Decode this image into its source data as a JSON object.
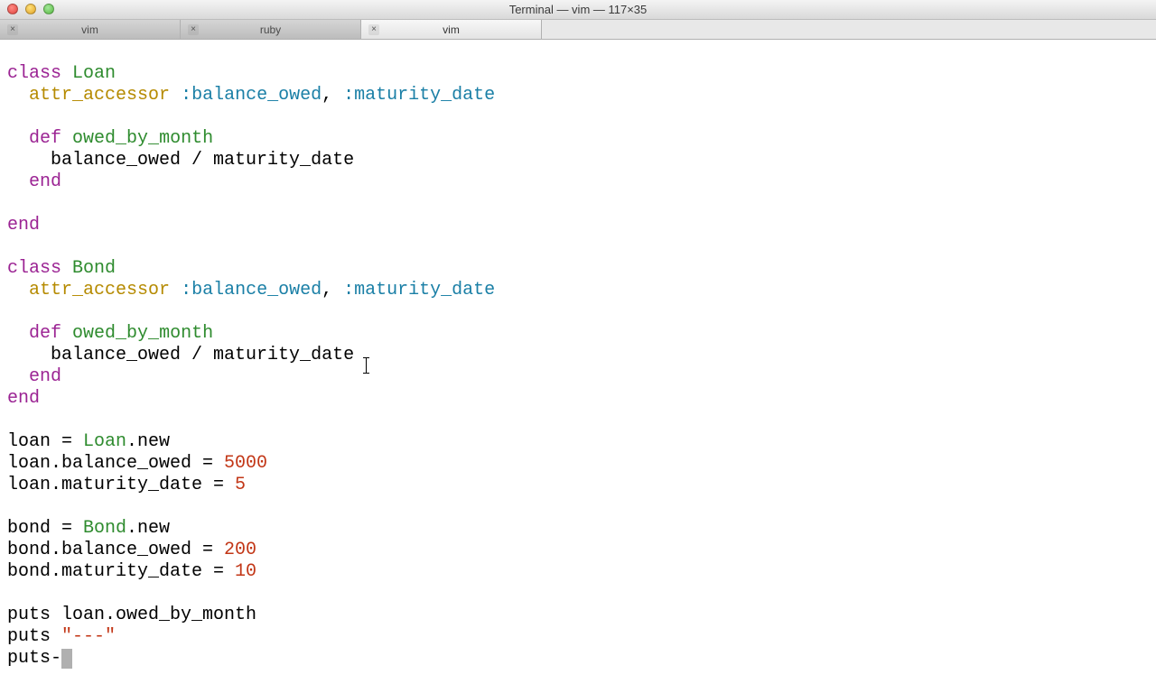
{
  "window": {
    "title": "Terminal — vim — 117×35"
  },
  "tabs": [
    {
      "label": "vim",
      "active": false
    },
    {
      "label": "ruby",
      "active": false
    },
    {
      "label": "vim",
      "active": true
    }
  ],
  "code": {
    "class1_kw": "class",
    "class1_name": "Loan",
    "attr_kw": "attr_accessor",
    "sym_balance": ":balance_owed",
    "sym_maturity": ":maturity_date",
    "def_kw": "def",
    "method_name": "owed_by_month",
    "body_line": "balance_owed / maturity_date",
    "end_kw": "end",
    "class2_kw": "class",
    "class2_name": "Bond",
    "loan_assign": "loan = ",
    "loan_const": "Loan",
    "dot_new": ".new",
    "loan_bal_lhs": "loan.balance_owed = ",
    "loan_bal_val": "5000",
    "loan_mat_lhs": "loan.maturity_date = ",
    "loan_mat_val": "5",
    "bond_assign": "bond = ",
    "bond_const": "Bond",
    "bond_bal_lhs": "bond.balance_owed = ",
    "bond_bal_val": "200",
    "bond_mat_lhs": "bond.maturity_date = ",
    "bond_mat_val": "10",
    "puts1": "puts loan.owed_by_month",
    "puts2_lhs": "puts ",
    "puts2_str": "\"---\"",
    "puts3": "puts-"
  }
}
